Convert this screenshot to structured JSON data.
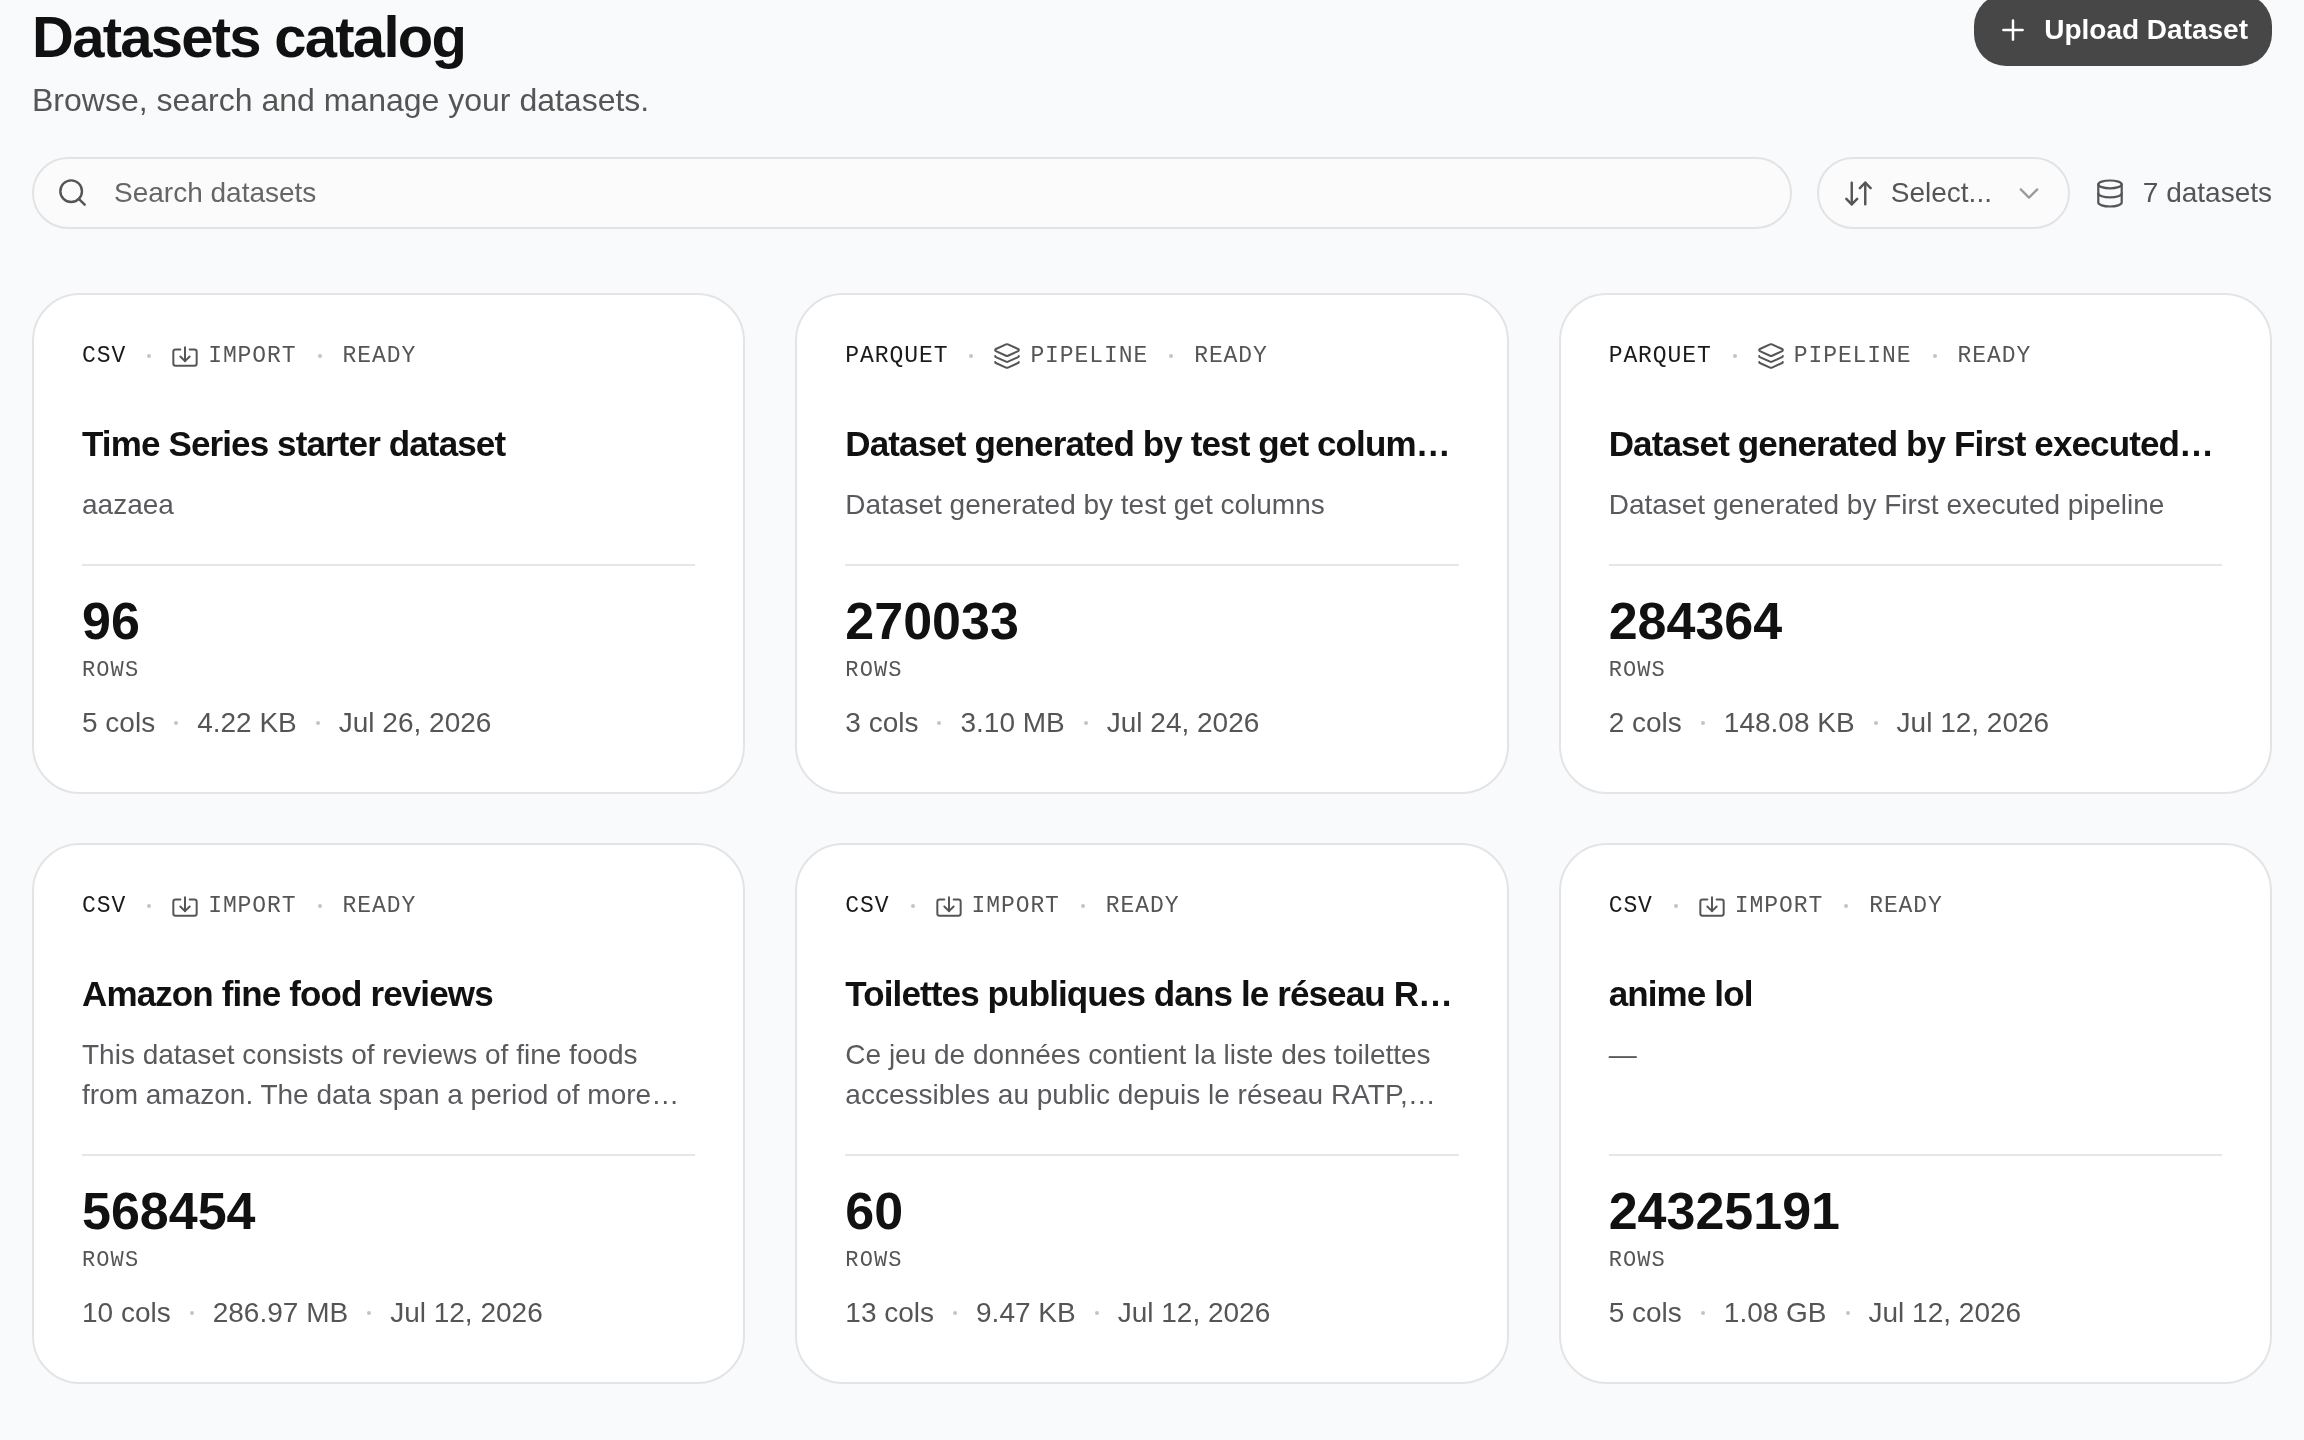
{
  "header": {
    "title": "Datasets catalog",
    "subtitle": "Browse, search and manage your datasets.",
    "upload_button": {
      "label": "Upload Dataset"
    }
  },
  "toolbar": {
    "search": {
      "placeholder": "Search datasets"
    },
    "sort": {
      "placeholder": "Select..."
    },
    "count": "7 datasets"
  },
  "datasets": [
    {
      "format": "CSV",
      "source": {
        "kind": "import",
        "label": "IMPORT"
      },
      "status": "READY",
      "title": "Time Series starter dataset",
      "description": "aazaea",
      "rows": "96",
      "rows_label": "ROWS",
      "stats": [
        "5 cols",
        "4.22 KB",
        "Jul 26, 2026"
      ]
    },
    {
      "format": "PARQUET",
      "source": {
        "kind": "pipeline",
        "label": "PIPELINE"
      },
      "status": "READY",
      "title": "Dataset generated by test get colum…",
      "description": "Dataset generated by test get columns",
      "rows": "270033",
      "rows_label": "ROWS",
      "stats": [
        "3 cols",
        "3.10 MB",
        "Jul 24, 2026"
      ]
    },
    {
      "format": "PARQUET",
      "source": {
        "kind": "pipeline",
        "label": "PIPELINE"
      },
      "status": "READY",
      "title": "Dataset generated by First executed…",
      "description": "Dataset generated by First executed pipeline",
      "rows": "284364",
      "rows_label": "ROWS",
      "stats": [
        "2 cols",
        "148.08 KB",
        "Jul 12, 2026"
      ]
    },
    {
      "format": "CSV",
      "source": {
        "kind": "import",
        "label": "IMPORT"
      },
      "status": "READY",
      "title": "Amazon fine food reviews",
      "description": "This dataset consists of reviews of fine foods from amazon. The data span a period of more…",
      "rows": "568454",
      "rows_label": "ROWS",
      "stats": [
        "10 cols",
        "286.97 MB",
        "Jul 12, 2026"
      ]
    },
    {
      "format": "CSV",
      "source": {
        "kind": "import",
        "label": "IMPORT"
      },
      "status": "READY",
      "title": "Toilettes publiques dans le réseau R…",
      "description": "Ce jeu de données contient la liste des toilettes accessibles au public depuis le réseau RATP,…",
      "rows": "60",
      "rows_label": "ROWS",
      "stats": [
        "13 cols",
        "9.47 KB",
        "Jul 12, 2026"
      ]
    },
    {
      "format": "CSV",
      "source": {
        "kind": "import",
        "label": "IMPORT"
      },
      "status": "READY",
      "title": "anime lol",
      "description": "—",
      "rows": "24325191",
      "rows_label": "ROWS",
      "stats": [
        "5 cols",
        "1.08 GB",
        "Jul 12, 2026"
      ]
    }
  ]
}
